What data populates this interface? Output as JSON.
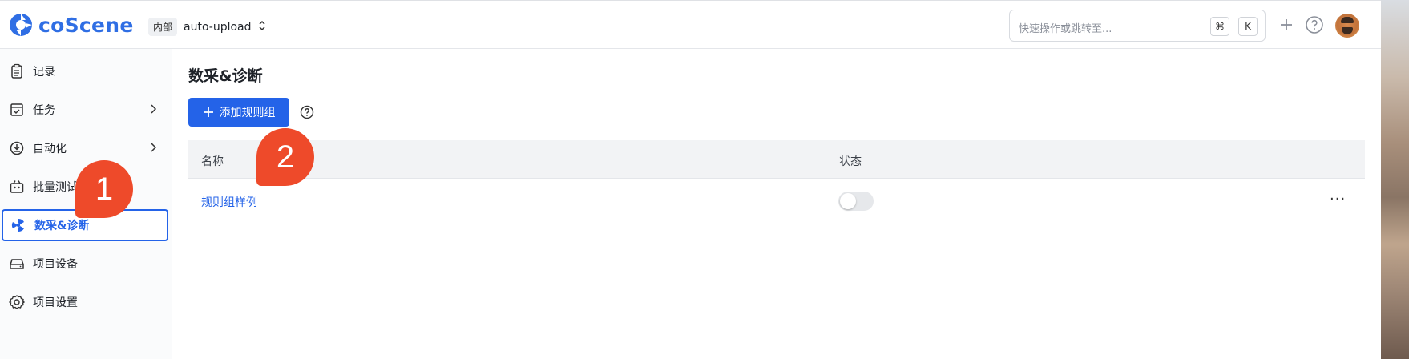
{
  "header": {
    "logo_text": "coScene",
    "project_tag": "内部",
    "project_name": "auto-upload",
    "search_placeholder": "快速操作或跳转至...",
    "kbd_cmd": "⌘",
    "kbd_k": "K"
  },
  "sidebar": {
    "items": [
      {
        "label": "记录",
        "icon": "records-icon"
      },
      {
        "label": "任务",
        "icon": "task-icon",
        "has_chevron": true
      },
      {
        "label": "自动化",
        "icon": "automation-icon",
        "has_chevron": true
      },
      {
        "label": "批量测试",
        "icon": "batch-test-icon"
      },
      {
        "label": "数采&诊断",
        "icon": "diagnosis-icon",
        "active": true
      },
      {
        "label": "项目设备",
        "icon": "device-icon"
      },
      {
        "label": "项目设置",
        "icon": "gear-icon"
      }
    ]
  },
  "main": {
    "title": "数采&诊断",
    "add_button": "添加规则组",
    "table": {
      "headers": [
        "名称",
        "状态"
      ],
      "rows": [
        {
          "name": "规则组样例",
          "enabled": false
        }
      ]
    },
    "more_label": "···"
  },
  "callouts": [
    "1",
    "2"
  ],
  "colors": {
    "accent": "#2463e8",
    "brand": "#2f6ee4",
    "callout": "#ee4a2a"
  }
}
